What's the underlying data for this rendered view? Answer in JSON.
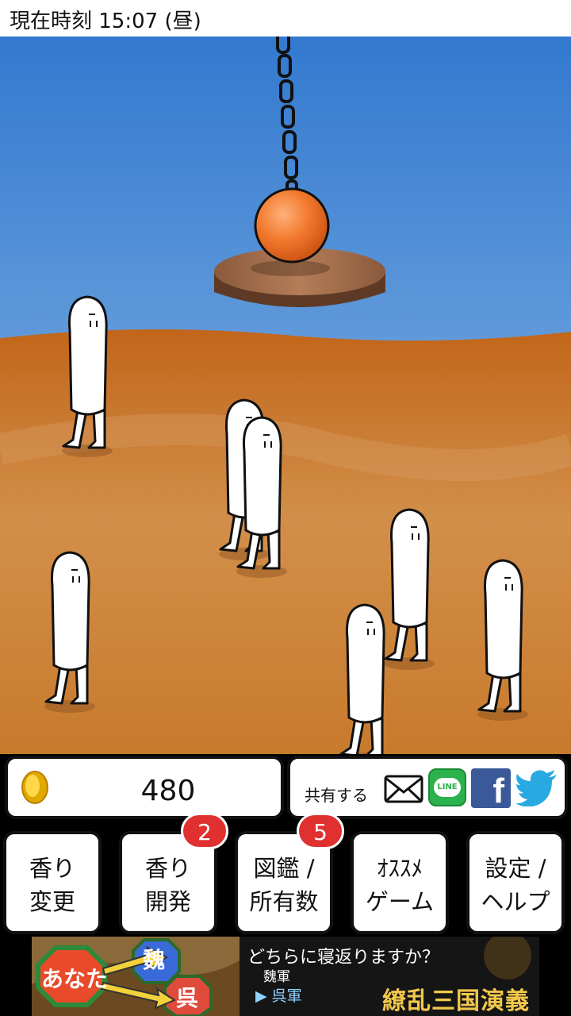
{
  "status_bar": {
    "time_text": "現在時刻 15:07 (昼)"
  },
  "coins": {
    "value": "480"
  },
  "share": {
    "label": "共有する",
    "icons": [
      "mail-icon",
      "line-icon",
      "facebook-icon",
      "twitter-icon"
    ],
    "line_text": "LINE",
    "facebook_text": "f"
  },
  "menu": {
    "buttons": [
      {
        "line1": "香り",
        "line2": "変更"
      },
      {
        "line1": "香り",
        "line2": "開発",
        "badge": "2"
      },
      {
        "line1": "図鑑 /",
        "line2": "所有数",
        "badge": "5"
      },
      {
        "line1": "ｵｽｽﾒ",
        "line2": "ゲーム"
      },
      {
        "line1": "設定 /",
        "line2": "ヘルプ"
      }
    ]
  },
  "ad": {
    "question": "どちらに寝返りますか？",
    "option1": "魏軍",
    "option2": "▶ 呉軍",
    "logo": "繚乱三国演義",
    "flag_you": "あなた",
    "flag_wei": "魏",
    "flag_wu": "呉"
  },
  "colors": {
    "sky": "#3c85d6",
    "ground": "#c97a2a",
    "ball": "#f07830",
    "badge": "#e03030"
  }
}
